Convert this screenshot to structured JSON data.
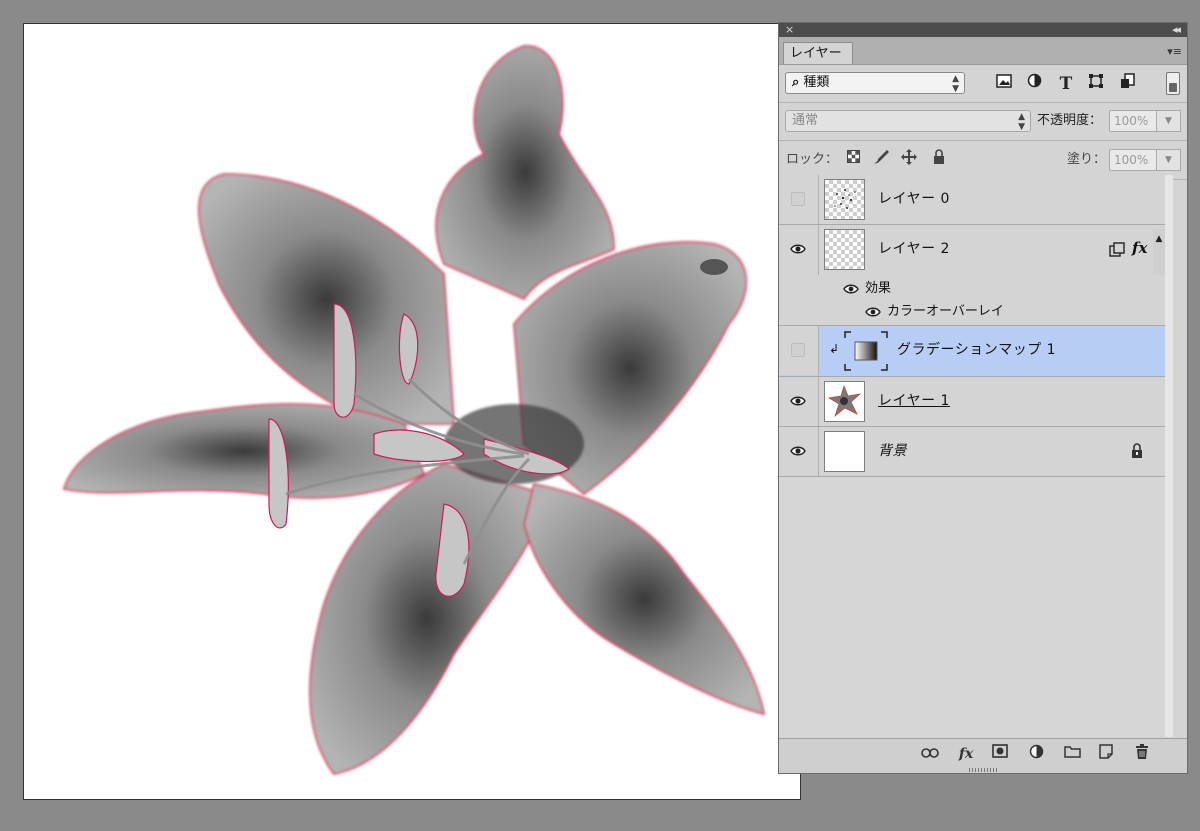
{
  "panel": {
    "close_glyph": "×",
    "collapse_glyph": "◂◂",
    "tab_label": "レイヤー",
    "tab_menu_glyph": "▾≡",
    "filter": {
      "search_glyph": "⌕",
      "kind_value": "種類",
      "icons": [
        "image-filter-icon",
        "adjustment-filter-icon",
        "type-filter-icon",
        "shape-filter-icon",
        "smartobject-filter-icon"
      ],
      "type_glyph": "T"
    },
    "blend": {
      "mode_value": "通常",
      "opacity_label": "不透明度：",
      "opacity_value": "100%"
    },
    "lock": {
      "label": "ロック：",
      "fill_label": "塗り：",
      "fill_value": "100%"
    },
    "layers": [
      {
        "name": "レイヤー 0",
        "visible": false
      },
      {
        "name": "レイヤー 2",
        "visible": true,
        "effects_label": "効果",
        "effect_name": "カラーオーバーレイ",
        "fx_glyph": "fx"
      },
      {
        "name": "グラデーションマップ 1",
        "visible": false,
        "selected": true
      },
      {
        "name": "レイヤー 1",
        "visible": true
      },
      {
        "name": "背景",
        "visible": true,
        "locked": true
      }
    ],
    "bottom": {
      "fx_glyph": "fx"
    }
  },
  "colors": {
    "selection": "#b7cdf5",
    "outline": "#d4175a",
    "panel_bg": "#d4d4d4",
    "workspace": "#8a8a8a"
  }
}
